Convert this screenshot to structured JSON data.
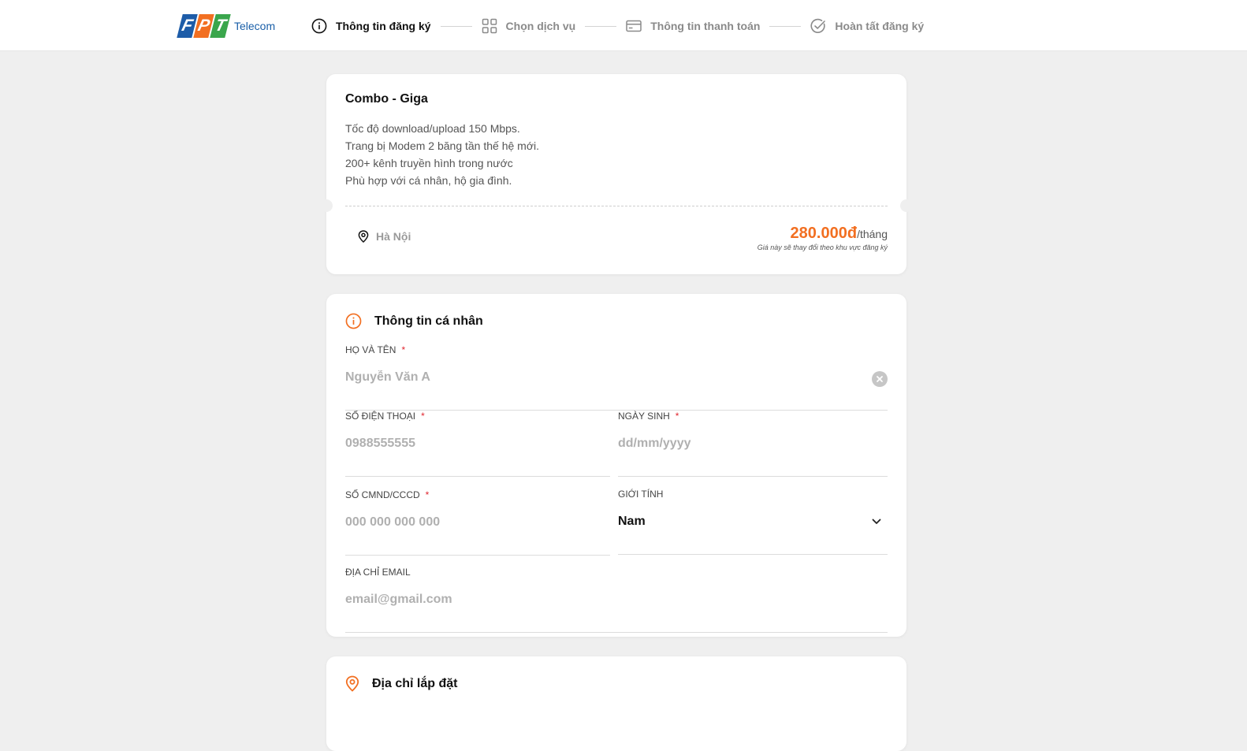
{
  "brand": {
    "letters": [
      "F",
      "P",
      "T"
    ],
    "letter_colors": [
      "#1d5ca8",
      "#f26f21",
      "#3aa64c"
    ],
    "suffix": "Telecom"
  },
  "steps": [
    {
      "label": "Thông tin đăng ký",
      "icon": "info-icon",
      "active": true
    },
    {
      "label": "Chọn dịch vụ",
      "icon": "grid-icon",
      "active": false
    },
    {
      "label": "Thông tin thanh toán",
      "icon": "card-icon",
      "active": false
    },
    {
      "label": "Hoàn tất đăng ký",
      "icon": "check-circle-icon",
      "active": false
    }
  ],
  "package": {
    "title": "Combo - Giga",
    "features": [
      "Tốc độ download/upload 150 Mbps.",
      "Trang bị Modem 2 băng tần thế hệ mới.",
      "200+ kênh truyền hình trong nước",
      "Phù hợp với cá nhân, hộ gia đình."
    ],
    "location": "Hà Nội",
    "price": "280.000đ",
    "price_unit": "/tháng",
    "price_note": "Giá này sẽ thay đổi theo khu vực đăng ký"
  },
  "personal": {
    "title": "Thông tin cá nhân",
    "fields": {
      "name": {
        "label": "HỌ VÀ TÊN",
        "placeholder": "Nguyễn Văn A",
        "required": "*"
      },
      "phone": {
        "label": "SỐ ĐIỆN THOẠI",
        "placeholder": "0988555555",
        "required": "*"
      },
      "dob": {
        "label": "NGÀY SINH",
        "placeholder": "dd/mm/yyyy",
        "required": "*"
      },
      "id": {
        "label": "SỐ CMND/CCCD",
        "placeholder": "000 000 000 000",
        "required": "*"
      },
      "gender": {
        "label": "GIỚI TÍNH",
        "value": "Nam"
      },
      "email": {
        "label": "ĐỊA CHỈ EMAIL",
        "placeholder": "email@gmail.com"
      }
    }
  },
  "address": {
    "title": "Địa chỉ lắp đặt"
  },
  "colors": {
    "accent": "#f26f21",
    "required": "#e0262f",
    "background": "#efefef"
  }
}
